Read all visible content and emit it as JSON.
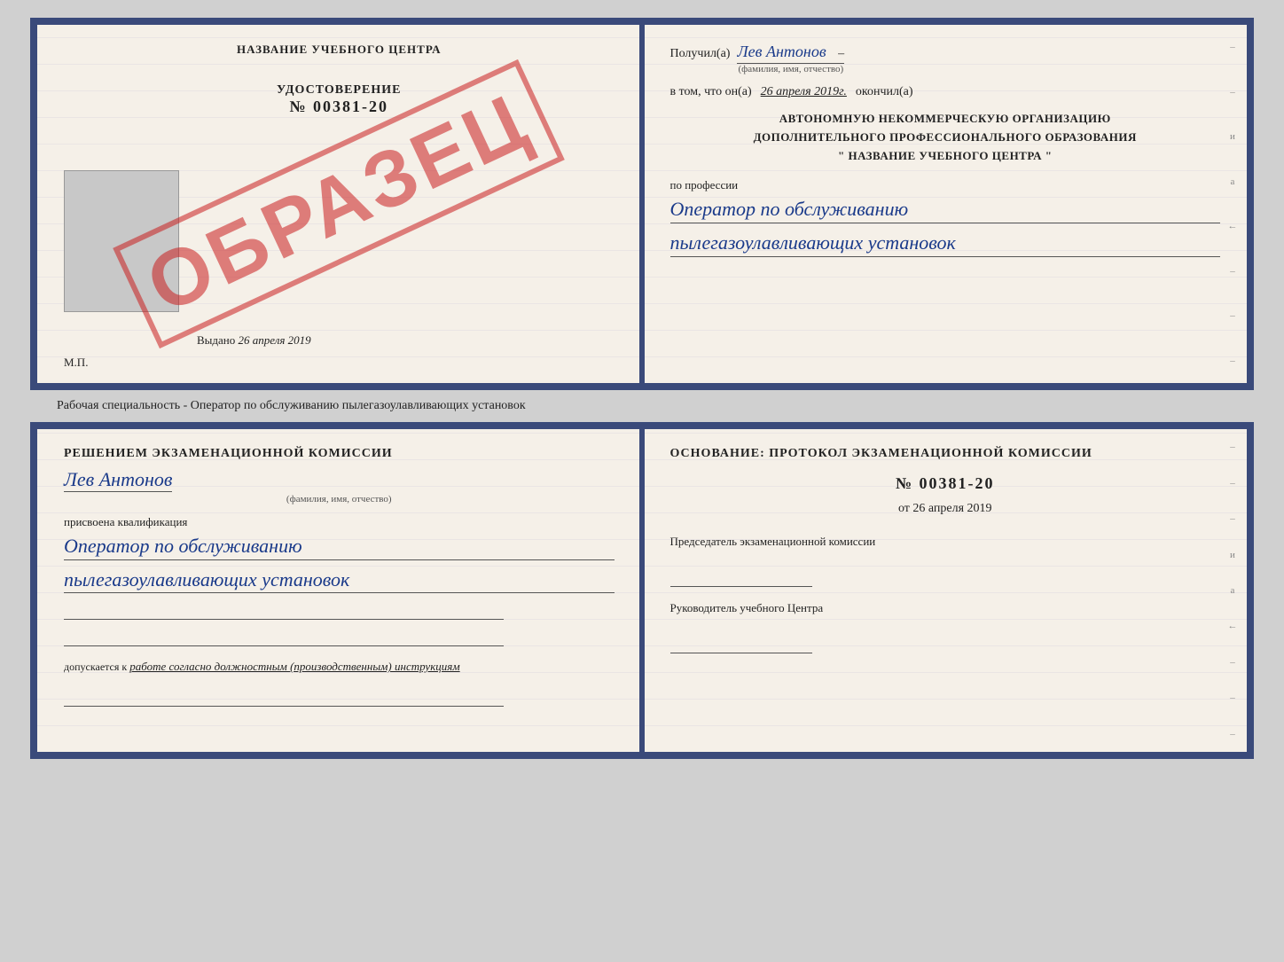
{
  "page": {
    "background": "#d0d0d0"
  },
  "cert_book": {
    "left": {
      "title": "НАЗВАНИЕ УЧЕБНОГО ЦЕНТРА",
      "doc_label": "УДОСТОВЕРЕНИЕ",
      "doc_number": "№ 00381-20",
      "issued_label": "Выдано",
      "issued_date": "26 апреля 2019",
      "mp_label": "М.П.",
      "stamp_text": "ОБРАЗЕЦ"
    },
    "right": {
      "received_label": "Получил(а)",
      "received_name": "Лев Антонов",
      "received_subtitle": "(фамилия, имя, отчество)",
      "dash": "–",
      "date_prefix": "в том, что он(а)",
      "date_value": "26 апреля 2019г.",
      "date_suffix": "окончил(а)",
      "org_line1": "АВТОНОМНУЮ НЕКОММЕРЧЕСКУЮ ОРГАНИЗАЦИЮ",
      "org_line2": "ДОПОЛНИТЕЛЬНОГО ПРОФЕССИОНАЛЬНОГО ОБРАЗОВАНИЯ",
      "org_line3": "\"  НАЗВАНИЕ УЧЕБНОГО ЦЕНТРА  \"",
      "profession_label": "по профессии",
      "profession_line1": "Оператор по обслуживанию",
      "profession_line2": "пылегазоулавливающих установок",
      "side_marks": [
        "–",
        "–",
        "и",
        "а",
        "←",
        "–",
        "–",
        "–"
      ]
    }
  },
  "middle_text": "Рабочая специальность - Оператор по обслуживанию пылегазоулавливающих установок",
  "qual_book": {
    "left": {
      "decision_label": "Решением экзаменационной комиссии",
      "person_name": "Лев Антонов",
      "person_subtitle": "(фамилия, имя, отчество)",
      "assigned_label": "присвоена квалификация",
      "qual_line1": "Оператор по обслуживанию",
      "qual_line2": "пылегазоулавливающих установок",
      "allowed_label": "допускается к",
      "allowed_value": "работе согласно должностным (производственным) инструкциям"
    },
    "right": {
      "basis_label": "Основание: протокол экзаменационной комиссии",
      "protocol_num": "№ 00381-20",
      "protocol_date_prefix": "от",
      "protocol_date_value": "26 апреля 2019",
      "chairman_label": "Председатель экзаменационной комиссии",
      "director_label": "Руководитель учебного Центра",
      "side_marks": [
        "–",
        "–",
        "–",
        "и",
        "а",
        "←",
        "–",
        "–",
        "–"
      ]
    }
  }
}
